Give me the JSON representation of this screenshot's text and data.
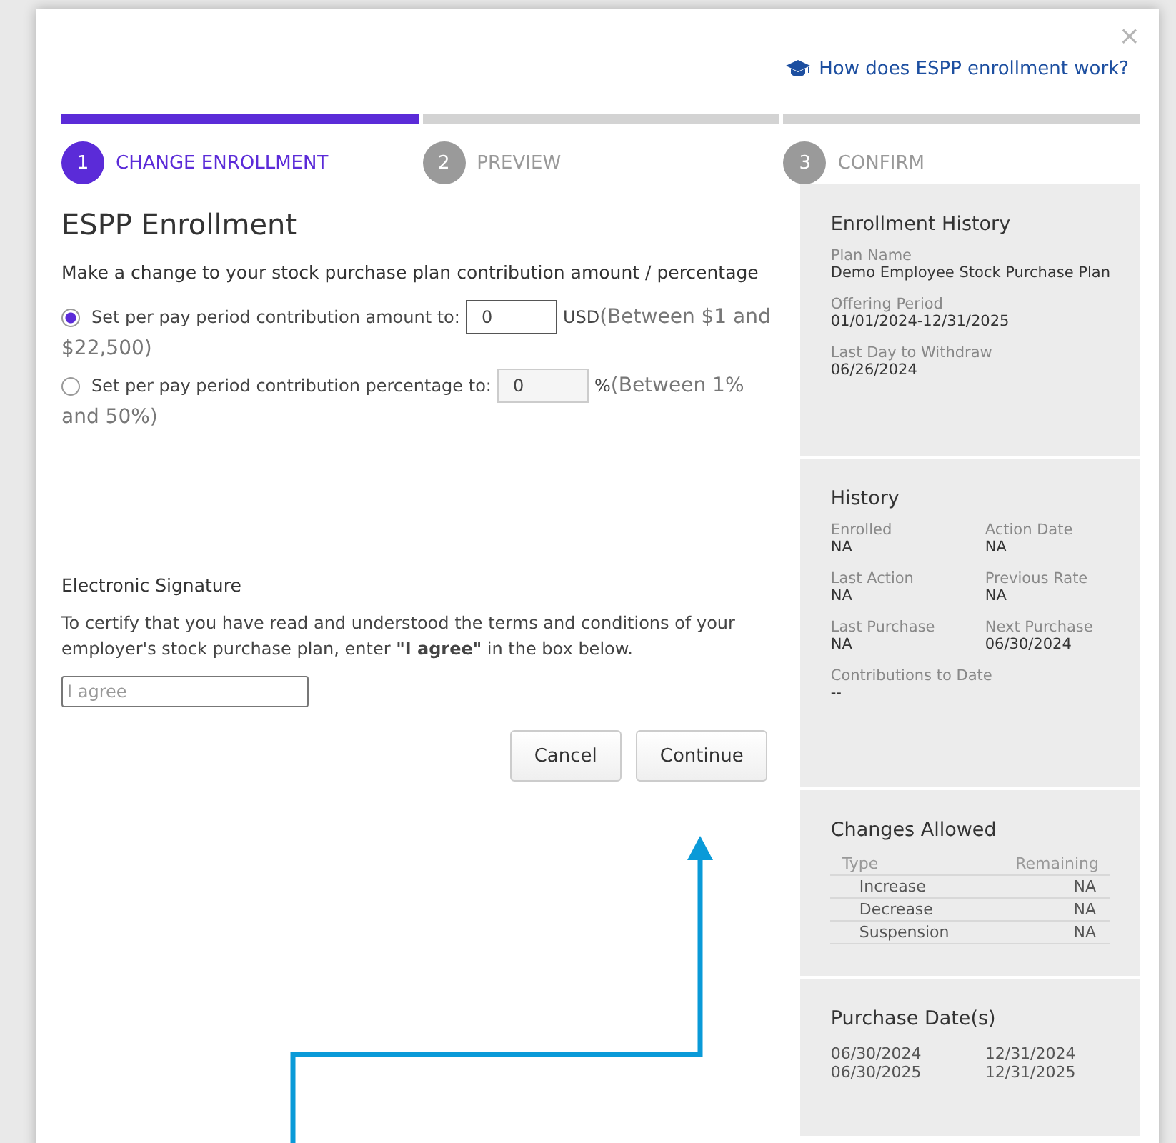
{
  "close": "×",
  "help_link": "How does ESPP enrollment work?",
  "steps": [
    {
      "number": "1",
      "label": "CHANGE ENROLLMENT",
      "selected": true
    },
    {
      "number": "2",
      "label": "PREVIEW",
      "selected": false
    },
    {
      "number": "3",
      "label": "CONFIRM",
      "selected": false
    }
  ],
  "title": "ESPP Enrollment",
  "instruction": "Make a change to your stock purchase plan contribution amount / percentage",
  "options": [
    {
      "label": "Set per pay period contribution amount to:",
      "value": "0",
      "unit": "USD",
      "range": "(Between $1 and",
      "range_continued": "$22,500)",
      "selected": true
    },
    {
      "label": "Set per pay period contribution percentage to:",
      "value": "0",
      "unit": "%",
      "range": "(Between 1%",
      "range_continued": "and 50%)",
      "selected": false
    }
  ],
  "signature": {
    "heading": "Electronic Signature",
    "text": "To certify that you have read and understood the terms and conditions of your employer's stock purchase plan, enter **\"I agree\"** in the box below.",
    "placeholder": "I agree"
  },
  "buttons": [
    "Cancel",
    "Continue"
  ],
  "enrollment_history": {
    "title": "Enrollment History",
    "fields": [
      {
        "label": "Plan Name",
        "value": "Demo Employee Stock Purchase Plan"
      },
      {
        "label": "Offering Period",
        "value": "01/01/2024-12/31/2025"
      },
      {
        "label": "Last Day to Withdraw",
        "value": "06/26/2024"
      }
    ]
  },
  "history": {
    "title": "History",
    "fields": [
      {
        "label": "Enrolled",
        "value": "NA"
      },
      {
        "label": "Action Date",
        "value": "NA"
      },
      {
        "label": "Last Action",
        "value": "NA"
      },
      {
        "label": "Previous Rate",
        "value": "NA"
      },
      {
        "label": "Last Purchase",
        "value": "NA"
      },
      {
        "label": "Next Purchase",
        "value": "06/30/2024"
      },
      {
        "label": "Contributions to Date",
        "value": "--"
      }
    ]
  },
  "changes_allowed": {
    "title": "Changes Allowed",
    "columns": [
      "Type",
      "Remaining"
    ],
    "rows": [
      {
        "type": "Increase",
        "remaining": "NA"
      },
      {
        "type": "Decrease",
        "remaining": "NA"
      },
      {
        "type": "Suspension",
        "remaining": "NA"
      }
    ]
  },
  "purchase_dates": {
    "title": "Purchase Date(s)",
    "dates": [
      "06/30/2024",
      "12/31/2024",
      "06/30/2025",
      "12/31/2025"
    ]
  }
}
